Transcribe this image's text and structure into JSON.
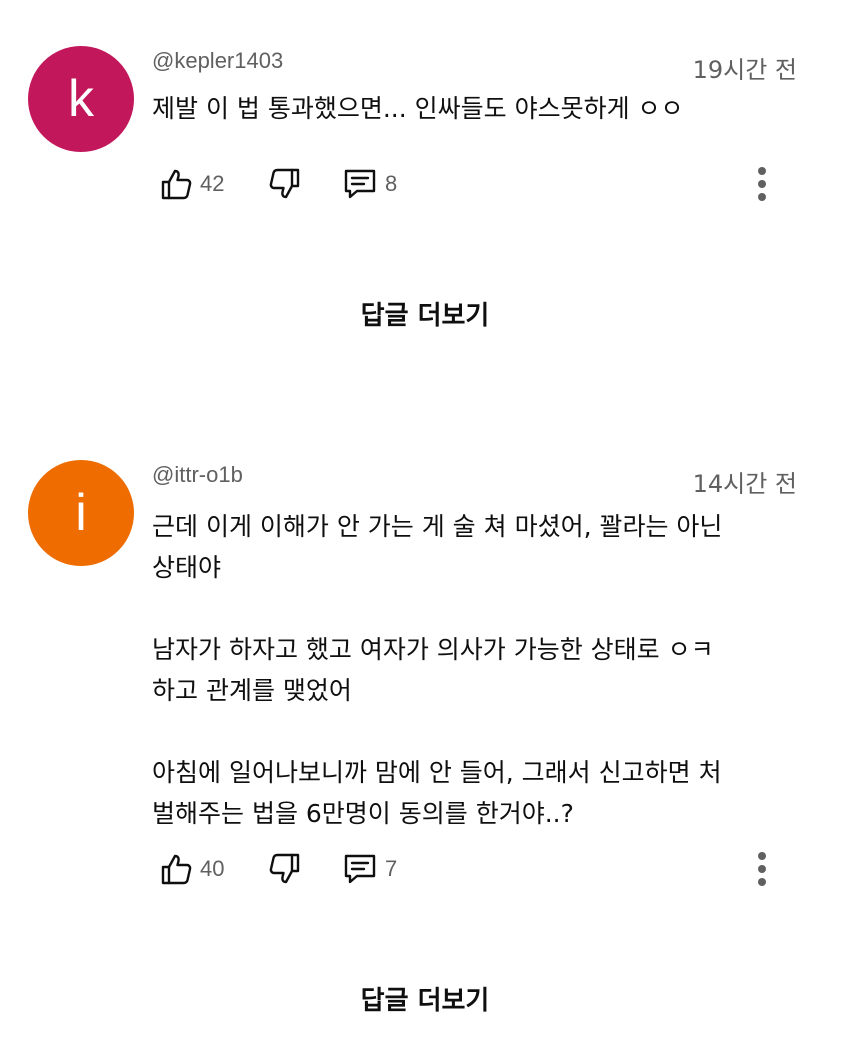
{
  "comments": [
    {
      "avatar_letter": "k",
      "avatar_color": "#c2185b",
      "handle": "@kepler1403",
      "time": "19시간 전",
      "text": "제발 이 법 통과했으면... 인싸들도 야스못하게 ㅇㅇ",
      "likes": "42",
      "replies_count": "8",
      "more_replies_label": "답글 더보기"
    },
    {
      "avatar_letter": "i",
      "avatar_color": "#ef6c00",
      "handle": "@ittr-o1b",
      "time": "14시간 전",
      "text": "근데 이게 이해가 안 가는 게 술 쳐 마셨어, 꽐라는 아닌\n상태야\n\n남자가 하자고 했고 여자가 의사가 가능한 상태로 ㅇㅋ\n하고 관계를 맺었어\n\n아침에 일어나보니까 맘에 안 들어, 그래서 신고하면 처\n벌해주는 법을 6만명이 동의를 한거야..?",
      "likes": "40",
      "replies_count": "7",
      "more_replies_label": "답글 더보기"
    }
  ]
}
